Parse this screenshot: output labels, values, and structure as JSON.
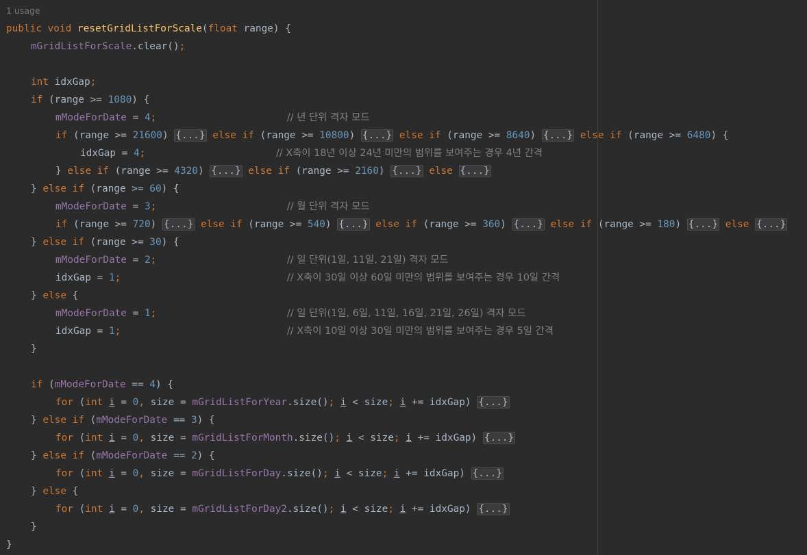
{
  "editor": {
    "usage_hint": "1 usage",
    "lines": [
      [
        [
          "kw",
          "public void "
        ],
        [
          "fn",
          "resetGridListForScale"
        ],
        [
          "op",
          "("
        ],
        [
          "kw",
          "float "
        ],
        [
          "txt",
          "range) {"
        ]
      ],
      [
        [
          "fld",
          "mGridListForScale"
        ],
        [
          "op",
          ".clear()"
        ],
        [
          "kw",
          ";"
        ]
      ],
      [],
      [
        [
          "kw",
          "int "
        ],
        [
          "txt",
          "idxGap"
        ],
        [
          "kw",
          ";"
        ]
      ],
      [
        [
          "kw",
          "if "
        ],
        [
          "op",
          "(range >= "
        ],
        [
          "num",
          "1080"
        ],
        [
          "op",
          ") {"
        ]
      ],
      [
        [
          "fld",
          "mModeForDate"
        ],
        [
          "op",
          " = "
        ],
        [
          "num",
          "4"
        ],
        [
          "kw",
          ";"
        ],
        [
          "pad",
          "                      "
        ],
        [
          "cm",
          "// 년 단위 격자 모드"
        ]
      ],
      [
        [
          "kw",
          "if "
        ],
        [
          "op",
          "(range >= "
        ],
        [
          "num",
          "21600"
        ],
        [
          "op",
          ") "
        ],
        [
          "fold",
          "{...}"
        ],
        [
          "kw",
          " else if "
        ],
        [
          "op",
          "(range >= "
        ],
        [
          "num",
          "10800"
        ],
        [
          "op",
          ") "
        ],
        [
          "fold",
          "{...}"
        ],
        [
          "kw",
          " else if "
        ],
        [
          "op",
          "(range >= "
        ],
        [
          "num",
          "8640"
        ],
        [
          "op",
          ") "
        ],
        [
          "fold",
          "{...}"
        ],
        [
          "kw",
          " else if "
        ],
        [
          "op",
          "(range >= "
        ],
        [
          "num",
          "6480"
        ],
        [
          "op",
          ") {"
        ]
      ],
      [
        [
          "txt",
          "idxGap"
        ],
        [
          "op",
          " = "
        ],
        [
          "num",
          "4"
        ],
        [
          "kw",
          ";"
        ],
        [
          "pad",
          "                      "
        ],
        [
          "cm",
          "// X축이 18년 이상 24년 미만의 범위를 보여주는 경우 4년 간격"
        ]
      ],
      [
        [
          "op",
          "} "
        ],
        [
          "kw",
          "else if "
        ],
        [
          "op",
          "(range >= "
        ],
        [
          "num",
          "4320"
        ],
        [
          "op",
          ") "
        ],
        [
          "fold",
          "{...}"
        ],
        [
          "kw",
          " else if "
        ],
        [
          "op",
          "(range >= "
        ],
        [
          "num",
          "2160"
        ],
        [
          "op",
          ") "
        ],
        [
          "fold",
          "{...}"
        ],
        [
          "kw",
          " else "
        ],
        [
          "fold",
          "{...}"
        ]
      ],
      [
        [
          "op",
          "} "
        ],
        [
          "kw",
          "else if "
        ],
        [
          "op",
          "(range >= "
        ],
        [
          "num",
          "60"
        ],
        [
          "op",
          ") {"
        ]
      ],
      [
        [
          "fld",
          "mModeForDate"
        ],
        [
          "op",
          " = "
        ],
        [
          "num",
          "3"
        ],
        [
          "kw",
          ";"
        ],
        [
          "pad",
          "                      "
        ],
        [
          "cm",
          "// 월 단위 격자 모드"
        ]
      ],
      [
        [
          "kw",
          "if "
        ],
        [
          "op",
          "(range >= "
        ],
        [
          "num",
          "720"
        ],
        [
          "op",
          ") "
        ],
        [
          "fold",
          "{...}"
        ],
        [
          "kw",
          " else if "
        ],
        [
          "op",
          "(range >= "
        ],
        [
          "num",
          "540"
        ],
        [
          "op",
          ") "
        ],
        [
          "fold",
          "{...}"
        ],
        [
          "kw",
          " else if "
        ],
        [
          "op",
          "(range >= "
        ],
        [
          "num",
          "360"
        ],
        [
          "op",
          ") "
        ],
        [
          "fold",
          "{...}"
        ],
        [
          "kw",
          " else if "
        ],
        [
          "op",
          "(range >= "
        ],
        [
          "num",
          "180"
        ],
        [
          "op",
          ") "
        ],
        [
          "fold",
          "{...}"
        ],
        [
          "kw",
          " else "
        ],
        [
          "fold",
          "{...}"
        ]
      ],
      [
        [
          "op",
          "} "
        ],
        [
          "kw",
          "else if "
        ],
        [
          "op",
          "(range >= "
        ],
        [
          "num",
          "30"
        ],
        [
          "op",
          ") {"
        ]
      ],
      [
        [
          "fld",
          "mModeForDate"
        ],
        [
          "op",
          " = "
        ],
        [
          "num",
          "2"
        ],
        [
          "kw",
          ";"
        ],
        [
          "pad",
          "                      "
        ],
        [
          "cm",
          "// 일 단위(1일, 11일, 21일) 격자 모드"
        ]
      ],
      [
        [
          "txt",
          "idxGap"
        ],
        [
          "op",
          " = "
        ],
        [
          "num",
          "1"
        ],
        [
          "kw",
          ";"
        ],
        [
          "pad",
          "                            "
        ],
        [
          "cm",
          "// X축이 30일 이상 60일 미만의 범위를 보여주는 경우 10일 간격"
        ]
      ],
      [
        [
          "op",
          "} "
        ],
        [
          "kw",
          "else "
        ],
        [
          "op",
          "{"
        ]
      ],
      [
        [
          "fld",
          "mModeForDate"
        ],
        [
          "op",
          " = "
        ],
        [
          "num",
          "1"
        ],
        [
          "kw",
          ";"
        ],
        [
          "pad",
          "                      "
        ],
        [
          "cm",
          "// 일 단위(1일, 6일, 11일, 16일, 21일, 26일) 격자 모드"
        ]
      ],
      [
        [
          "txt",
          "idxGap"
        ],
        [
          "op",
          " = "
        ],
        [
          "num",
          "1"
        ],
        [
          "kw",
          ";"
        ],
        [
          "pad",
          "                            "
        ],
        [
          "cm",
          "// X축이 10일 이상 30일 미만의 범위를 보여주는 경우 5일 간격"
        ]
      ],
      [
        [
          "op",
          "}"
        ]
      ],
      [],
      [
        [
          "kw",
          "if "
        ],
        [
          "op",
          "("
        ],
        [
          "fld",
          "mModeForDate"
        ],
        [
          "op",
          " == "
        ],
        [
          "num",
          "4"
        ],
        [
          "op",
          ") {"
        ]
      ],
      [
        [
          "kw",
          "for "
        ],
        [
          "op",
          "("
        ],
        [
          "kw",
          "int "
        ],
        [
          "lv",
          "i"
        ],
        [
          "op",
          " = "
        ],
        [
          "num",
          "0"
        ],
        [
          "kw",
          ", "
        ],
        [
          "txt",
          "size = "
        ],
        [
          "fld",
          "mGridListForYear"
        ],
        [
          "op",
          ".size()"
        ],
        [
          "kw",
          "; "
        ],
        [
          "lv",
          "i"
        ],
        [
          "op",
          " < size"
        ],
        [
          "kw",
          "; "
        ],
        [
          "lv",
          "i"
        ],
        [
          "op",
          " += idxGap) "
        ],
        [
          "fold",
          "{...}"
        ]
      ],
      [
        [
          "op",
          "} "
        ],
        [
          "kw",
          "else if "
        ],
        [
          "op",
          "("
        ],
        [
          "fld",
          "mModeForDate"
        ],
        [
          "op",
          " == "
        ],
        [
          "num",
          "3"
        ],
        [
          "op",
          ") {"
        ]
      ],
      [
        [
          "kw",
          "for "
        ],
        [
          "op",
          "("
        ],
        [
          "kw",
          "int "
        ],
        [
          "lv",
          "i"
        ],
        [
          "op",
          " = "
        ],
        [
          "num",
          "0"
        ],
        [
          "kw",
          ", "
        ],
        [
          "txt",
          "size = "
        ],
        [
          "fld",
          "mGridListForMonth"
        ],
        [
          "op",
          ".size()"
        ],
        [
          "kw",
          "; "
        ],
        [
          "lv",
          "i"
        ],
        [
          "op",
          " < size"
        ],
        [
          "kw",
          "; "
        ],
        [
          "lv",
          "i"
        ],
        [
          "op",
          " += idxGap) "
        ],
        [
          "fold",
          "{...}"
        ]
      ],
      [
        [
          "op",
          "} "
        ],
        [
          "kw",
          "else if "
        ],
        [
          "op",
          "("
        ],
        [
          "fld",
          "mModeForDate"
        ],
        [
          "op",
          " == "
        ],
        [
          "num",
          "2"
        ],
        [
          "op",
          ") {"
        ]
      ],
      [
        [
          "kw",
          "for "
        ],
        [
          "op",
          "("
        ],
        [
          "kw",
          "int "
        ],
        [
          "lv",
          "i"
        ],
        [
          "op",
          " = "
        ],
        [
          "num",
          "0"
        ],
        [
          "kw",
          ", "
        ],
        [
          "txt",
          "size = "
        ],
        [
          "fld",
          "mGridListForDay"
        ],
        [
          "op",
          ".size()"
        ],
        [
          "kw",
          "; "
        ],
        [
          "lv",
          "i"
        ],
        [
          "op",
          " < size"
        ],
        [
          "kw",
          "; "
        ],
        [
          "lv",
          "i"
        ],
        [
          "op",
          " += idxGap) "
        ],
        [
          "fold",
          "{...}"
        ]
      ],
      [
        [
          "op",
          "} "
        ],
        [
          "kw",
          "else "
        ],
        [
          "op",
          "{"
        ]
      ],
      [
        [
          "kw",
          "for "
        ],
        [
          "op",
          "("
        ],
        [
          "kw",
          "int "
        ],
        [
          "lv",
          "i"
        ],
        [
          "op",
          " = "
        ],
        [
          "num",
          "0"
        ],
        [
          "kw",
          ", "
        ],
        [
          "txt",
          "size = "
        ],
        [
          "fld",
          "mGridListForDay2"
        ],
        [
          "op",
          ".size()"
        ],
        [
          "kw",
          "; "
        ],
        [
          "lv",
          "i"
        ],
        [
          "op",
          " < size"
        ],
        [
          "kw",
          "; "
        ],
        [
          "lv",
          "i"
        ],
        [
          "op",
          " += idxGap) "
        ],
        [
          "fold",
          "{...}"
        ]
      ],
      [
        [
          "op",
          "}"
        ]
      ],
      [
        [
          "op",
          "}"
        ]
      ]
    ]
  },
  "colors": {
    "background": "#2b2b2b",
    "keyword": "#cc7832",
    "function": "#ffc66d",
    "field": "#9876aa",
    "number": "#6897bb",
    "comment": "#808080",
    "text": "#a9b7c6"
  }
}
